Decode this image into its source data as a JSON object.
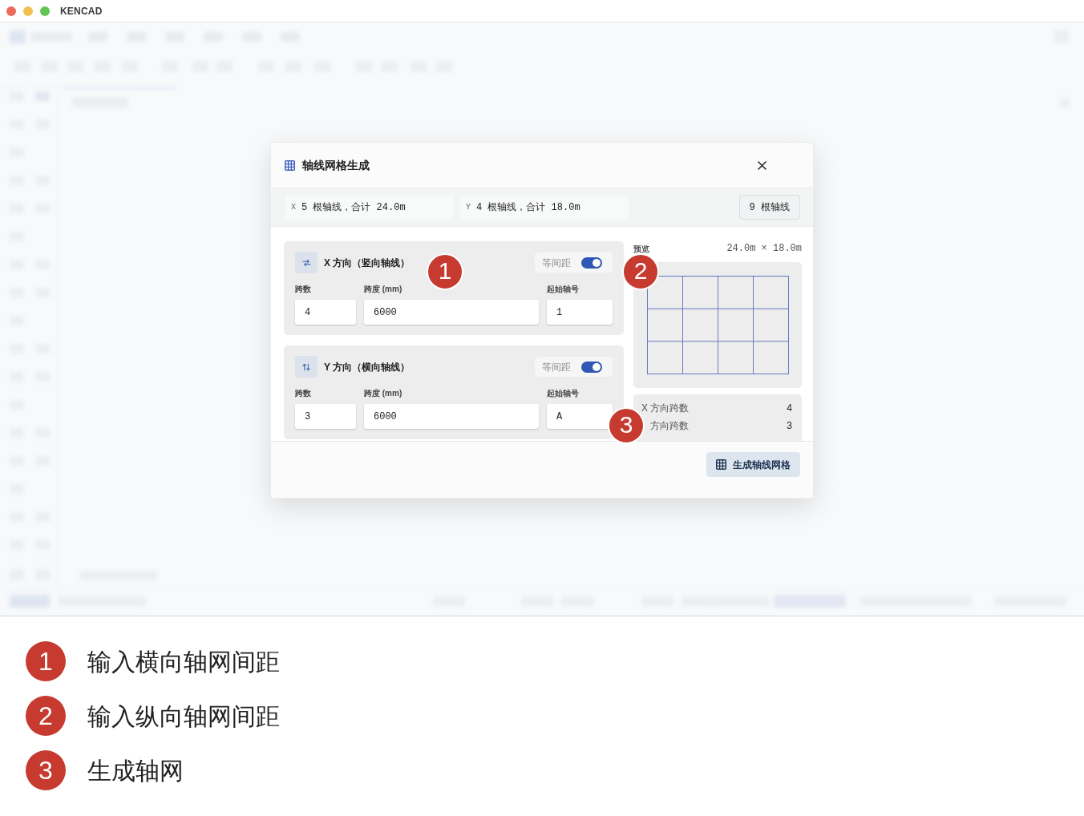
{
  "window": {
    "title": "KENCAD"
  },
  "dialog": {
    "title": "轴线网格生成",
    "summary": [
      {
        "axis": "X",
        "text": "5 根轴线，合计 24.0m"
      },
      {
        "axis": "Y",
        "text": "4 根轴线，合计 18.0m"
      }
    ],
    "total_button": "9 根轴线",
    "directions": [
      {
        "kind": "horizontal",
        "title": "X 方向（竖向轴线）",
        "toggle": {
          "label": "等间距",
          "on": true
        },
        "fields": [
          {
            "label": "跨数",
            "value": "4"
          },
          {
            "label": "跨度 (mm)",
            "value": "6000"
          },
          {
            "label": "起始轴号",
            "value": "1"
          }
        ]
      },
      {
        "kind": "vertical",
        "title": "Y 方向（横向轴线）",
        "toggle": {
          "label": "等间距",
          "on": true
        },
        "fields": [
          {
            "label": "跨数",
            "value": "3"
          },
          {
            "label": "跨度 (mm)",
            "value": "6000"
          },
          {
            "label": "起始轴号",
            "value": "A"
          }
        ]
      }
    ],
    "preview": {
      "label": "预览",
      "size": "24.0m × 18.0m"
    },
    "stats": [
      {
        "axis": "X",
        "label": "方向跨数",
        "value": "4"
      },
      {
        "label": "方向跨数",
        "value": "3"
      }
    ],
    "generate_button": "生成轴线网格"
  },
  "markers": [
    {
      "number": "1"
    },
    {
      "number": "2"
    },
    {
      "number": "3"
    }
  ],
  "legend": [
    {
      "number": "1",
      "text": "输入横向轴网间距"
    },
    {
      "number": "2",
      "text": "输入纵向轴网间距"
    },
    {
      "number": "3",
      "text": "生成轴网"
    }
  ]
}
